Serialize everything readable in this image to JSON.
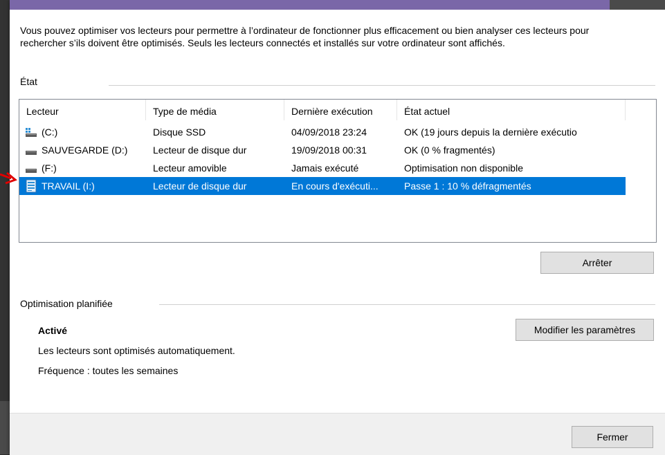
{
  "intro_text": "Vous pouvez optimiser vos lecteurs pour permettre à l’ordinateur de fonctionner plus efficacement ou bien analyser ces lecteurs pour rechercher s’ils doivent être optimisés. Seuls les lecteurs connectés et installés sur votre ordinateur sont affichés.",
  "state_group_label": "État",
  "columns": [
    "Lecteur",
    "Type de média",
    "Dernière exécution",
    "État actuel"
  ],
  "drives": [
    {
      "name": "(C:)",
      "media": "Disque SSD",
      "last_run": "04/09/2018 23:24",
      "status": "OK (19 jours depuis la dernière exécutio",
      "icon": "ssd-drive-icon"
    },
    {
      "name": "SAUVEGARDE (D:)",
      "media": "Lecteur de disque dur",
      "last_run": "19/09/2018 00:31",
      "status": "OK (0 % fragmentés)",
      "icon": "hard-drive-icon"
    },
    {
      "name": "(F:)",
      "media": "Lecteur amovible",
      "last_run": "Jamais exécuté",
      "status": "Optimisation non disponible",
      "icon": "removable-drive-icon"
    },
    {
      "name": "TRAVAIL (I:)",
      "media": "Lecteur de disque dur",
      "last_run": "En cours d'exécuti...",
      "status": "Passe 1 : 10 % défragmentés",
      "icon": "defrag-in-progress-icon",
      "selected": true
    }
  ],
  "stop_button_label": "Arrêter",
  "schedule_group_label": "Optimisation planifiée",
  "schedule_status": "Activé",
  "schedule_description": "Les lecteurs sont optimisés automatiquement.",
  "schedule_frequency": "Fréquence : toutes les semaines",
  "modify_button_label": "Modifier les paramètres",
  "close_button_label": "Fermer",
  "colors": {
    "accent": "#7a67a8",
    "selection": "#0078d7",
    "annotation_arrow": "#e00000"
  }
}
